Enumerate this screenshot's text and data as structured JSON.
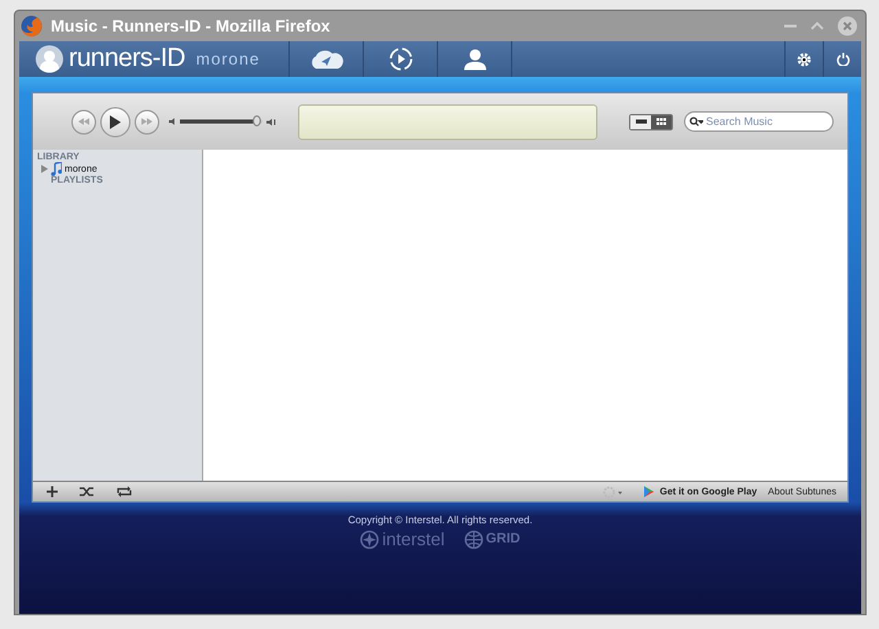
{
  "window": {
    "title": "Music - Runners-ID - Mozilla Firefox"
  },
  "nav": {
    "brand": "runners-ID",
    "user": "morone"
  },
  "player": {
    "volume": {
      "level": 0.93
    },
    "search": {
      "placeholder": "Search Music"
    },
    "views": [
      {
        "kind": "list",
        "selected": false
      },
      {
        "kind": "grid",
        "selected": true
      }
    ]
  },
  "sidebar": {
    "sections": [
      {
        "title": "LIBRARY",
        "items": [
          {
            "label": "morone",
            "expanded": false
          }
        ]
      },
      {
        "title": "PLAYLISTS"
      }
    ]
  },
  "bottom_bar": {
    "store_link": "Get it on Google Play",
    "about_link": "About Subtunes"
  },
  "footer": {
    "copyright": "Copyright © Interstel. All rights reserved.",
    "logos": [
      "interstel",
      "GRID"
    ]
  }
}
